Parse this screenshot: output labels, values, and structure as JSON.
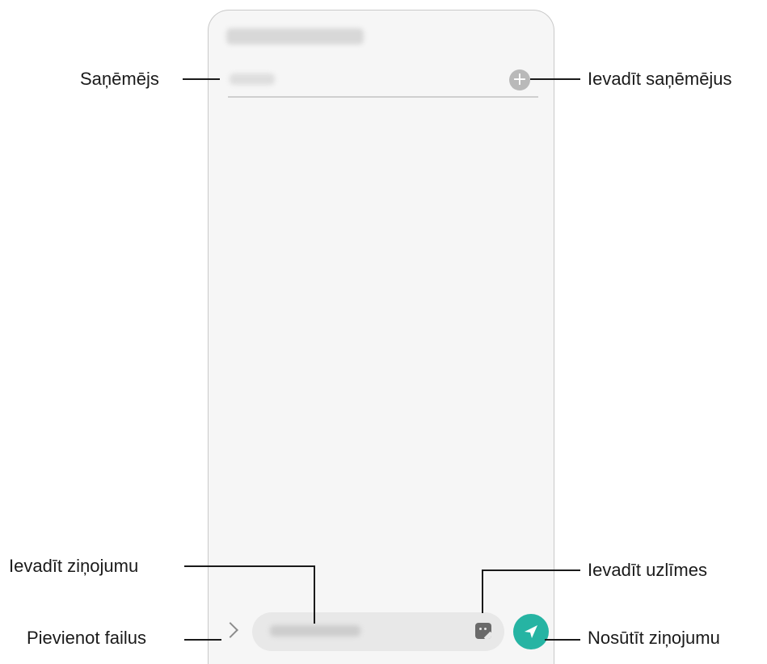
{
  "screen": {
    "add_recipient_glyph": "+",
    "attach_icon": "chevron-right-icon",
    "sticker_icon": "sticker-icon",
    "send_icon": "send-icon",
    "accent_color": "#26b4a3"
  },
  "callouts": {
    "recipient": "Saņēmējs",
    "enter_recipients": "Ievadīt saņēmējus",
    "enter_message": "Ievadīt ziņojumu",
    "enter_stickers": "Ievadīt uzlīmes",
    "attach_files": "Pievienot failus",
    "send_message": "Nosūtīt ziņojumu"
  }
}
